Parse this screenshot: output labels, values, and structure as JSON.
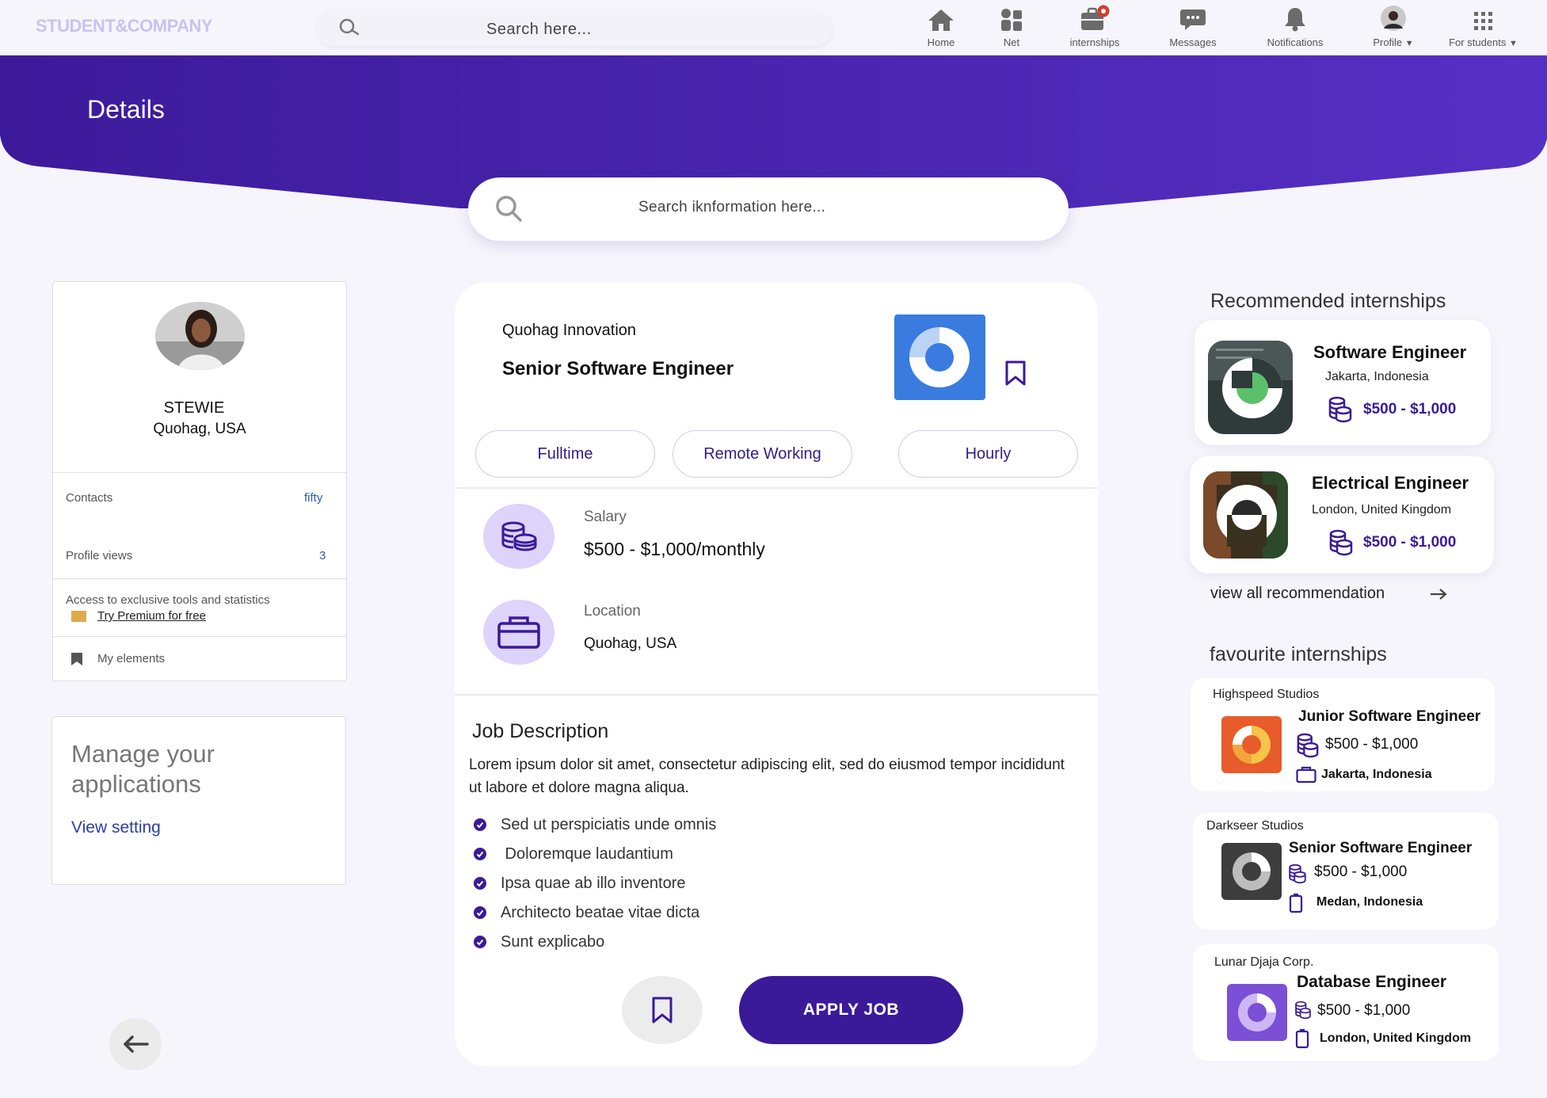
{
  "brand": "STUDENT&COMPANY",
  "top_search": {
    "placeholder": "Search  here..."
  },
  "nav": [
    {
      "label": "Home",
      "icon": "home-icon"
    },
    {
      "label": "Net",
      "icon": "network-icon"
    },
    {
      "label": "internships",
      "icon": "briefcase-icon"
    },
    {
      "label": "Messages",
      "icon": "chat-icon"
    },
    {
      "label": "Notifications",
      "icon": "bell-icon"
    },
    {
      "label": "Profile",
      "icon": "avatar"
    },
    {
      "label": "For students",
      "icon": "grid-icon"
    }
  ],
  "hero": {
    "title": "Details"
  },
  "big_search": {
    "placeholder": "Search iknformation  here..."
  },
  "profile": {
    "name": "STEWIE",
    "location": "Quohag, USA",
    "contacts_label": "Contacts",
    "contacts_value": "fifty",
    "views_label": "Profile views",
    "views_value": "3",
    "premium_text": "Access to exclusive tools and statistics",
    "premium_link": "Try Premium for free",
    "elements_label": "My elements"
  },
  "manage": {
    "title": "Manage your applications",
    "link": "View setting"
  },
  "job": {
    "company": "Quohag Innovation",
    "title": "Senior Software Engineer",
    "tags": [
      "Fulltime",
      "Remote Working",
      "Hourly"
    ],
    "salary_label": "Salary",
    "salary_value": "$500 - $1,000/monthly",
    "location_label": "Location",
    "location_value": "Quohag, USA",
    "description_title": "Job Description",
    "description": "Lorem ipsum dolor sit amet, consectetur adipiscing elit, sed do eiusmod tempor incididunt ut labore et dolore magna aliqua.",
    "bullets": [
      "Sed ut perspiciatis unde omnis",
      " Doloremque laudantium",
      "Ipsa quae ab illo inventore",
      "Architecto beatae vitae dicta",
      "Sunt explicabo"
    ],
    "apply_label": "APPLY JOB"
  },
  "recommended": {
    "title": "Recommended internships",
    "items": [
      {
        "title": "Software Engineer",
        "location": "Jakarta, Indonesia",
        "salary": "$500 - $1,000"
      },
      {
        "title": "Electrical Engineer",
        "location": "London, United Kingdom",
        "salary": "$500 - $1,000"
      }
    ],
    "view_all": "view all recommendation"
  },
  "favourite": {
    "title": "favourite internships",
    "items": [
      {
        "company": "Highspeed Studios",
        "title": "Junior Software Engineer",
        "salary": "$500 - $1,000",
        "location": "Jakarta, Indonesia",
        "color": "#e85b2a"
      },
      {
        "company": "Darkseer Studios",
        "title": "Senior Software Engineer",
        "salary": "$500 - $1,000",
        "location": "Medan, Indonesia",
        "color": "#3d3d3d"
      },
      {
        "company": "Lunar Djaja Corp.",
        "title": "Database Engineer",
        "salary": "$500 - $1,000",
        "location": "London, United Kingdom",
        "color": "#7b4fd6"
      }
    ]
  },
  "colors": {
    "accent": "#3a1a99",
    "hero_start": "#3c1a9a",
    "hero_end": "#5630c4",
    "tag_circle": "#ddd3fb",
    "job_logo": "#3a7be0"
  }
}
